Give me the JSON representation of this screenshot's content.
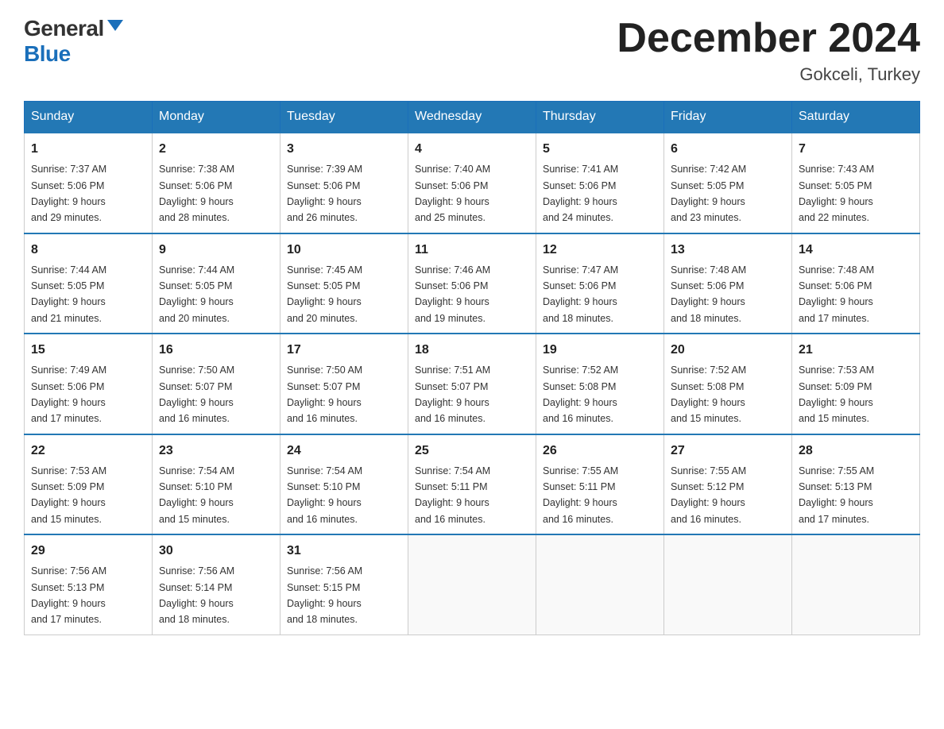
{
  "logo": {
    "general": "General",
    "blue": "Blue"
  },
  "title": "December 2024",
  "location": "Gokceli, Turkey",
  "days_of_week": [
    "Sunday",
    "Monday",
    "Tuesday",
    "Wednesday",
    "Thursday",
    "Friday",
    "Saturday"
  ],
  "weeks": [
    [
      {
        "day": "1",
        "sunrise": "7:37 AM",
        "sunset": "5:06 PM",
        "daylight": "9 hours and 29 minutes."
      },
      {
        "day": "2",
        "sunrise": "7:38 AM",
        "sunset": "5:06 PM",
        "daylight": "9 hours and 28 minutes."
      },
      {
        "day": "3",
        "sunrise": "7:39 AM",
        "sunset": "5:06 PM",
        "daylight": "9 hours and 26 minutes."
      },
      {
        "day": "4",
        "sunrise": "7:40 AM",
        "sunset": "5:06 PM",
        "daylight": "9 hours and 25 minutes."
      },
      {
        "day": "5",
        "sunrise": "7:41 AM",
        "sunset": "5:06 PM",
        "daylight": "9 hours and 24 minutes."
      },
      {
        "day": "6",
        "sunrise": "7:42 AM",
        "sunset": "5:05 PM",
        "daylight": "9 hours and 23 minutes."
      },
      {
        "day": "7",
        "sunrise": "7:43 AM",
        "sunset": "5:05 PM",
        "daylight": "9 hours and 22 minutes."
      }
    ],
    [
      {
        "day": "8",
        "sunrise": "7:44 AM",
        "sunset": "5:05 PM",
        "daylight": "9 hours and 21 minutes."
      },
      {
        "day": "9",
        "sunrise": "7:44 AM",
        "sunset": "5:05 PM",
        "daylight": "9 hours and 20 minutes."
      },
      {
        "day": "10",
        "sunrise": "7:45 AM",
        "sunset": "5:05 PM",
        "daylight": "9 hours and 20 minutes."
      },
      {
        "day": "11",
        "sunrise": "7:46 AM",
        "sunset": "5:06 PM",
        "daylight": "9 hours and 19 minutes."
      },
      {
        "day": "12",
        "sunrise": "7:47 AM",
        "sunset": "5:06 PM",
        "daylight": "9 hours and 18 minutes."
      },
      {
        "day": "13",
        "sunrise": "7:48 AM",
        "sunset": "5:06 PM",
        "daylight": "9 hours and 18 minutes."
      },
      {
        "day": "14",
        "sunrise": "7:48 AM",
        "sunset": "5:06 PM",
        "daylight": "9 hours and 17 minutes."
      }
    ],
    [
      {
        "day": "15",
        "sunrise": "7:49 AM",
        "sunset": "5:06 PM",
        "daylight": "9 hours and 17 minutes."
      },
      {
        "day": "16",
        "sunrise": "7:50 AM",
        "sunset": "5:07 PM",
        "daylight": "9 hours and 16 minutes."
      },
      {
        "day": "17",
        "sunrise": "7:50 AM",
        "sunset": "5:07 PM",
        "daylight": "9 hours and 16 minutes."
      },
      {
        "day": "18",
        "sunrise": "7:51 AM",
        "sunset": "5:07 PM",
        "daylight": "9 hours and 16 minutes."
      },
      {
        "day": "19",
        "sunrise": "7:52 AM",
        "sunset": "5:08 PM",
        "daylight": "9 hours and 16 minutes."
      },
      {
        "day": "20",
        "sunrise": "7:52 AM",
        "sunset": "5:08 PM",
        "daylight": "9 hours and 15 minutes."
      },
      {
        "day": "21",
        "sunrise": "7:53 AM",
        "sunset": "5:09 PM",
        "daylight": "9 hours and 15 minutes."
      }
    ],
    [
      {
        "day": "22",
        "sunrise": "7:53 AM",
        "sunset": "5:09 PM",
        "daylight": "9 hours and 15 minutes."
      },
      {
        "day": "23",
        "sunrise": "7:54 AM",
        "sunset": "5:10 PM",
        "daylight": "9 hours and 15 minutes."
      },
      {
        "day": "24",
        "sunrise": "7:54 AM",
        "sunset": "5:10 PM",
        "daylight": "9 hours and 16 minutes."
      },
      {
        "day": "25",
        "sunrise": "7:54 AM",
        "sunset": "5:11 PM",
        "daylight": "9 hours and 16 minutes."
      },
      {
        "day": "26",
        "sunrise": "7:55 AM",
        "sunset": "5:11 PM",
        "daylight": "9 hours and 16 minutes."
      },
      {
        "day": "27",
        "sunrise": "7:55 AM",
        "sunset": "5:12 PM",
        "daylight": "9 hours and 16 minutes."
      },
      {
        "day": "28",
        "sunrise": "7:55 AM",
        "sunset": "5:13 PM",
        "daylight": "9 hours and 17 minutes."
      }
    ],
    [
      {
        "day": "29",
        "sunrise": "7:56 AM",
        "sunset": "5:13 PM",
        "daylight": "9 hours and 17 minutes."
      },
      {
        "day": "30",
        "sunrise": "7:56 AM",
        "sunset": "5:14 PM",
        "daylight": "9 hours and 18 minutes."
      },
      {
        "day": "31",
        "sunrise": "7:56 AM",
        "sunset": "5:15 PM",
        "daylight": "9 hours and 18 minutes."
      },
      null,
      null,
      null,
      null
    ]
  ],
  "labels": {
    "sunrise": "Sunrise:",
    "sunset": "Sunset:",
    "daylight": "Daylight:"
  }
}
